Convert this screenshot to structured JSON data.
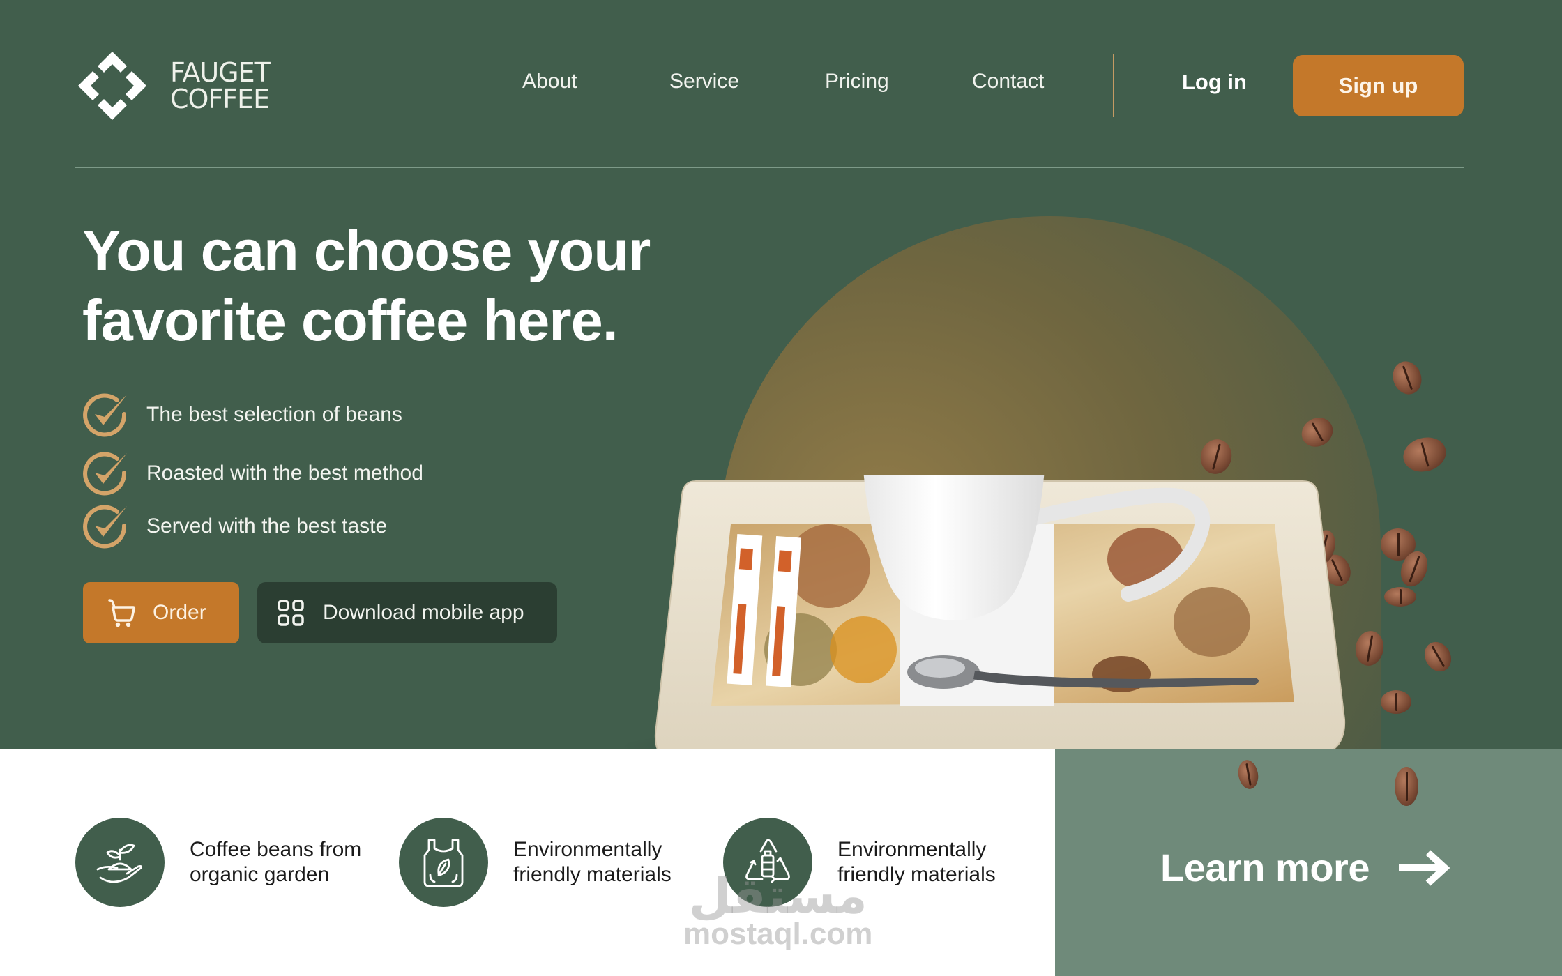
{
  "brand": {
    "name_line1": "FAUGET",
    "name_line2": "COFFEE",
    "logo_icon": "diamond-brackets-logo"
  },
  "nav": {
    "links": [
      {
        "label": "About"
      },
      {
        "label": "Service"
      },
      {
        "label": "Pricing"
      },
      {
        "label": "Contact"
      }
    ],
    "login_label": "Log in",
    "signup_label": "Sign up"
  },
  "hero": {
    "headline_line1": "You can choose your",
    "headline_line2": "favorite coffee here.",
    "features": [
      {
        "icon": "check-circle-icon",
        "text": "The best selection of beans"
      },
      {
        "icon": "check-circle-icon",
        "text": "Roasted with the best method"
      },
      {
        "icon": "check-circle-icon",
        "text": "Served with the best taste"
      }
    ],
    "order_button": {
      "icon": "cart-icon",
      "label": "Order"
    },
    "app_button": {
      "icon": "apps-grid-icon",
      "label": "Download mobile app"
    },
    "image_alt": "Latte cup on decorative seashell tray with sugar sticks, spoon and scattered coffee beans"
  },
  "perks": [
    {
      "icon": "hand-sprout-icon",
      "line1": "Coffee beans from",
      "line2": "organic garden"
    },
    {
      "icon": "eco-bag-icon",
      "line1": "Environmentally",
      "line2": "friendly materials"
    },
    {
      "icon": "recycle-bottle-icon",
      "line1": "Environmentally",
      "line2": "friendly materials"
    }
  ],
  "cta": {
    "label": "Learn more",
    "icon": "arrow-right-icon"
  },
  "watermark": {
    "arabic": "مستقل",
    "latin": "mostaql.com"
  },
  "colors": {
    "primary_green": "#415e4c",
    "accent_orange": "#c4782a",
    "dark_green": "#2b3e32",
    "sage": "#6f8a7a",
    "check_gold": "#d4a469"
  }
}
